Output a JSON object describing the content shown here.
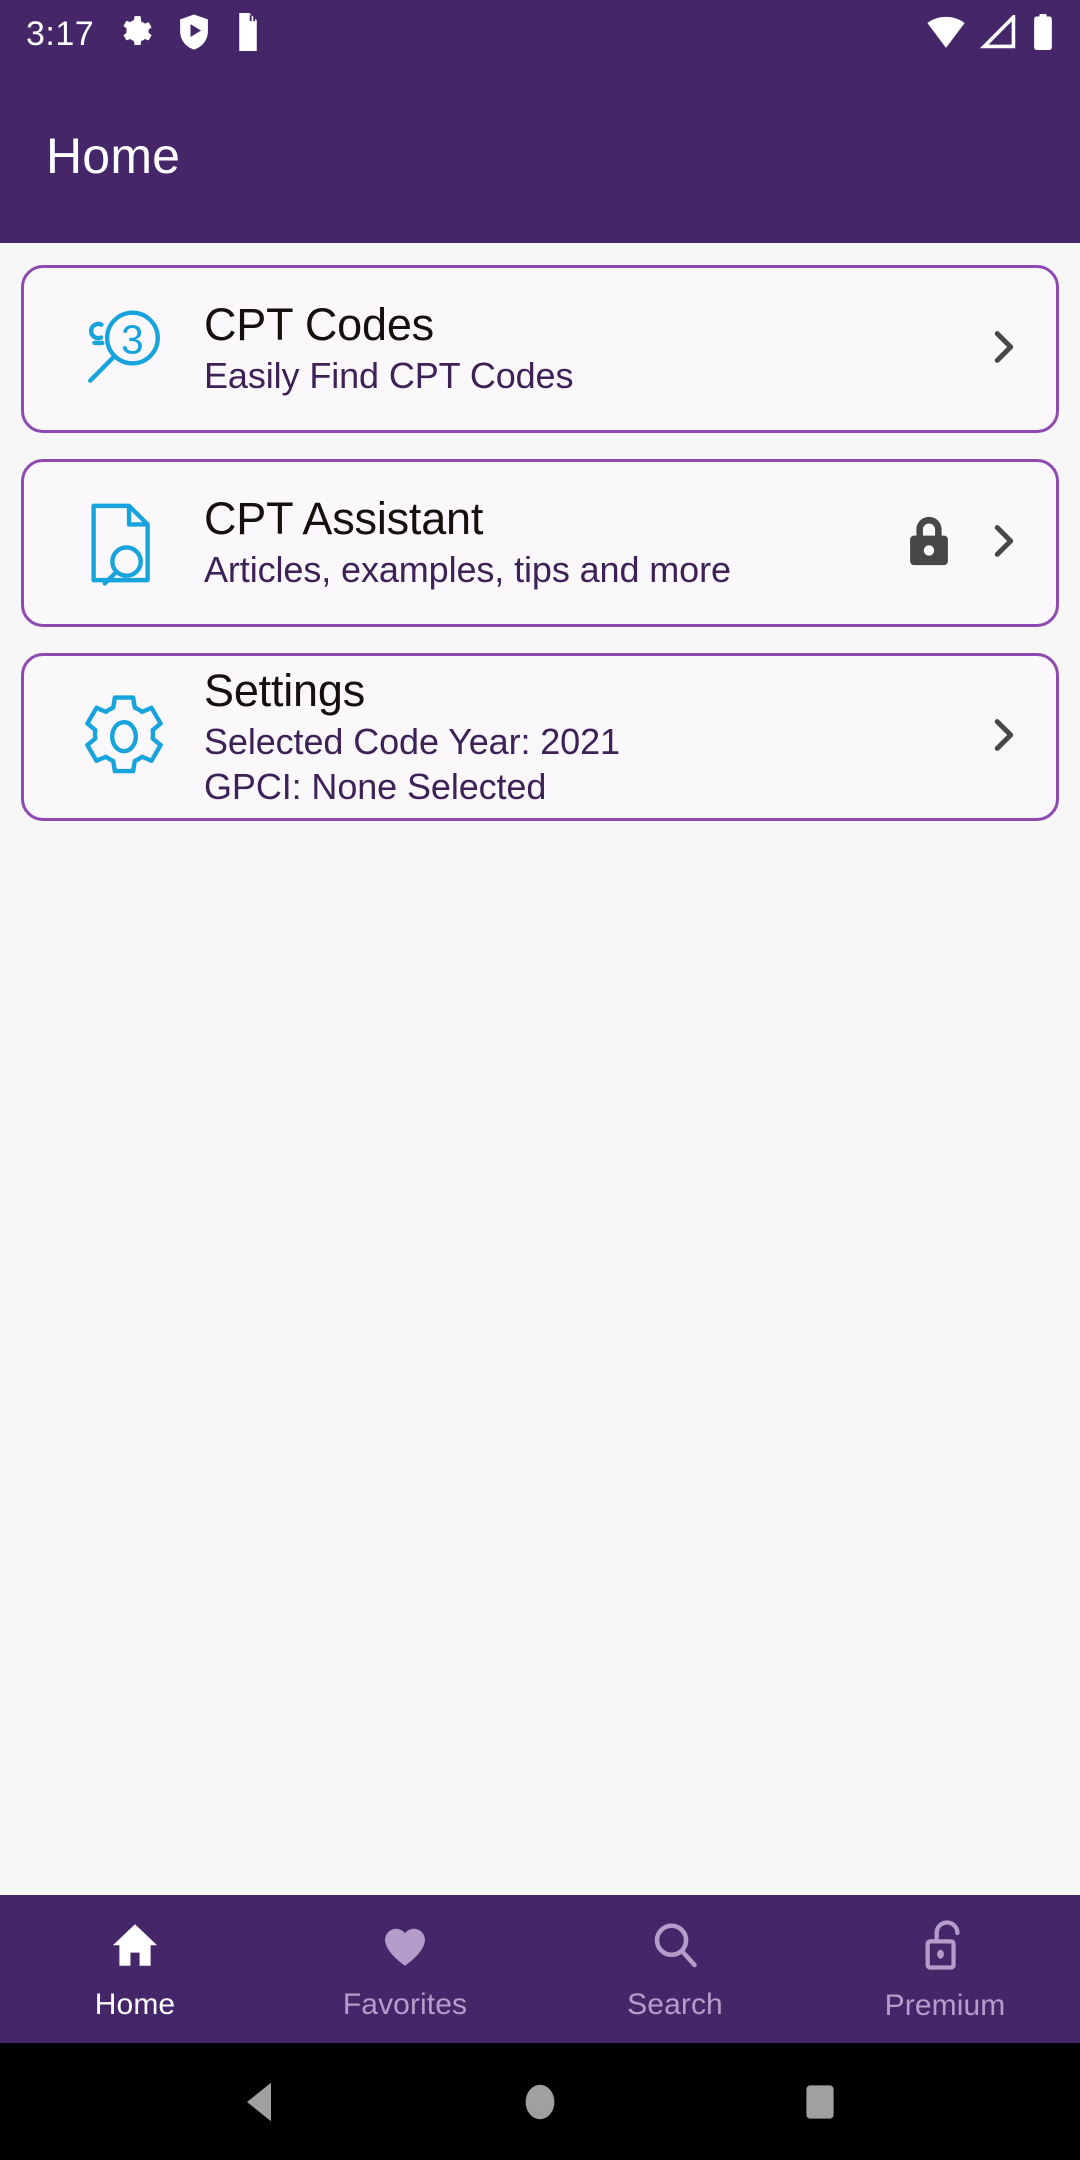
{
  "status_bar": {
    "time": "3:17",
    "left_icons": [
      "gear-icon",
      "shield-play-icon",
      "sd-card-icon"
    ],
    "right_icons": [
      "wifi-icon",
      "cell-signal-icon",
      "battery-icon"
    ],
    "background_color": "#452668",
    "foreground_color": "#ffffff"
  },
  "app_bar": {
    "title": "Home",
    "background_color": "#452668",
    "title_color": "#ffffff"
  },
  "theme": {
    "page_background": "#f8f7f8",
    "card_background": "#faf8fa",
    "card_border": "#8e4ab0",
    "accent_cyan": "#17a3dc",
    "title_color": "#15100f",
    "subtitle_color": "#3d2157",
    "chevron_color": "#474747",
    "lock_color": "#474747",
    "nav_active": "#ffffff",
    "nav_inactive": "#b49ccb"
  },
  "cards": [
    {
      "icon": "magnifier-three-icon",
      "title": "CPT Codes",
      "subtitles": [
        "Easily Find CPT Codes"
      ],
      "locked": false,
      "chevron": "chevron-right-icon"
    },
    {
      "icon": "document-search-icon",
      "title": "CPT Assistant",
      "subtitles": [
        "Articles, examples, tips and more"
      ],
      "locked": true,
      "lock_icon": "lock-closed-icon",
      "chevron": "chevron-right-icon"
    },
    {
      "icon": "gear-outline-icon",
      "title": "Settings",
      "subtitles": [
        "Selected Code Year: 2021",
        "GPCI: None Selected"
      ],
      "locked": false,
      "chevron": "chevron-right-icon"
    }
  ],
  "bottom_nav": {
    "items": [
      {
        "label": "Home",
        "icon": "home-icon",
        "active": true
      },
      {
        "label": "Favorites",
        "icon": "heart-icon",
        "active": false
      },
      {
        "label": "Search",
        "icon": "search-icon",
        "active": false
      },
      {
        "label": "Premium",
        "icon": "lock-open-icon",
        "active": false
      }
    ]
  },
  "system_nav": {
    "buttons": [
      "back-button",
      "home-button",
      "recents-button"
    ],
    "background_color": "#000000",
    "icon_color": "#a0a0a0"
  }
}
